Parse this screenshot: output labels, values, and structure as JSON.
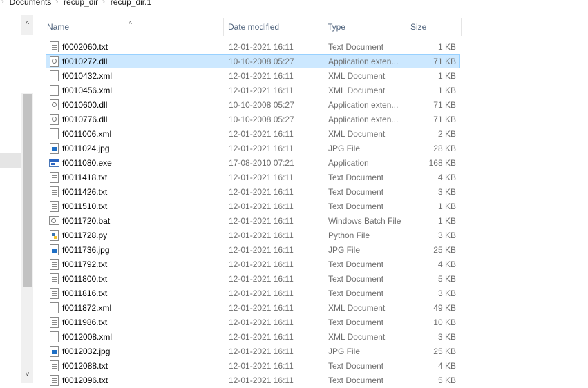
{
  "breadcrumb": [
    "Documents",
    "recup_dir",
    "recup_dir.1"
  ],
  "columns": {
    "name": "Name",
    "date": "Date modified",
    "type": "Type",
    "size": "Size"
  },
  "files": [
    {
      "name": "f0002060.txt",
      "date": "12-01-2021 16:11",
      "type": "Text Document",
      "size": "1 KB",
      "icon": "text-file-icon"
    },
    {
      "name": "f0010272.dll",
      "date": "10-10-2008 05:27",
      "type": "Application exten...",
      "size": "71 KB",
      "icon": "dll-file-icon",
      "selected": true
    },
    {
      "name": "f0010432.xml",
      "date": "12-01-2021 16:11",
      "type": "XML Document",
      "size": "1 KB",
      "icon": "xml-file-icon"
    },
    {
      "name": "f0010456.xml",
      "date": "12-01-2021 16:11",
      "type": "XML Document",
      "size": "1 KB",
      "icon": "xml-file-icon"
    },
    {
      "name": "f0010600.dll",
      "date": "10-10-2008 05:27",
      "type": "Application exten...",
      "size": "71 KB",
      "icon": "dll-file-icon"
    },
    {
      "name": "f0010776.dll",
      "date": "10-10-2008 05:27",
      "type": "Application exten...",
      "size": "71 KB",
      "icon": "dll-file-icon"
    },
    {
      "name": "f0011006.xml",
      "date": "12-01-2021 16:11",
      "type": "XML Document",
      "size": "2 KB",
      "icon": "xml-file-icon"
    },
    {
      "name": "f0011024.jpg",
      "date": "12-01-2021 16:11",
      "type": "JPG File",
      "size": "28 KB",
      "icon": "jpg-file-icon"
    },
    {
      "name": "f0011080.exe",
      "date": "17-08-2010 07:21",
      "type": "Application",
      "size": "168 KB",
      "icon": "exe-file-icon"
    },
    {
      "name": "f0011418.txt",
      "date": "12-01-2021 16:11",
      "type": "Text Document",
      "size": "4 KB",
      "icon": "text-file-icon"
    },
    {
      "name": "f0011426.txt",
      "date": "12-01-2021 16:11",
      "type": "Text Document",
      "size": "3 KB",
      "icon": "text-file-icon"
    },
    {
      "name": "f0011510.txt",
      "date": "12-01-2021 16:11",
      "type": "Text Document",
      "size": "1 KB",
      "icon": "text-file-icon"
    },
    {
      "name": "f0011720.bat",
      "date": "12-01-2021 16:11",
      "type": "Windows Batch File",
      "size": "1 KB",
      "icon": "bat-file-icon"
    },
    {
      "name": "f0011728.py",
      "date": "12-01-2021 16:11",
      "type": "Python File",
      "size": "3 KB",
      "icon": "python-file-icon"
    },
    {
      "name": "f0011736.jpg",
      "date": "12-01-2021 16:11",
      "type": "JPG File",
      "size": "25 KB",
      "icon": "jpg-file-icon"
    },
    {
      "name": "f0011792.txt",
      "date": "12-01-2021 16:11",
      "type": "Text Document",
      "size": "4 KB",
      "icon": "text-file-icon"
    },
    {
      "name": "f0011800.txt",
      "date": "12-01-2021 16:11",
      "type": "Text Document",
      "size": "5 KB",
      "icon": "text-file-icon"
    },
    {
      "name": "f0011816.txt",
      "date": "12-01-2021 16:11",
      "type": "Text Document",
      "size": "3 KB",
      "icon": "text-file-icon"
    },
    {
      "name": "f0011872.xml",
      "date": "12-01-2021 16:11",
      "type": "XML Document",
      "size": "49 KB",
      "icon": "xml-file-icon"
    },
    {
      "name": "f0011986.txt",
      "date": "12-01-2021 16:11",
      "type": "Text Document",
      "size": "10 KB",
      "icon": "text-file-icon"
    },
    {
      "name": "f0012008.xml",
      "date": "12-01-2021 16:11",
      "type": "XML Document",
      "size": "3 KB",
      "icon": "xml-file-icon"
    },
    {
      "name": "f0012032.jpg",
      "date": "12-01-2021 16:11",
      "type": "JPG File",
      "size": "25 KB",
      "icon": "jpg-file-icon"
    },
    {
      "name": "f0012088.txt",
      "date": "12-01-2021 16:11",
      "type": "Text Document",
      "size": "4 KB",
      "icon": "text-file-icon"
    },
    {
      "name": "f0012096.txt",
      "date": "12-01-2021 16:11",
      "type": "Text Document",
      "size": "5 KB",
      "icon": "text-file-icon"
    }
  ],
  "colors": {
    "selection_bg": "#cce8ff",
    "selection_border": "#99d1ff",
    "header_text": "#4c607a",
    "secondary_text": "#6d6d6d"
  }
}
